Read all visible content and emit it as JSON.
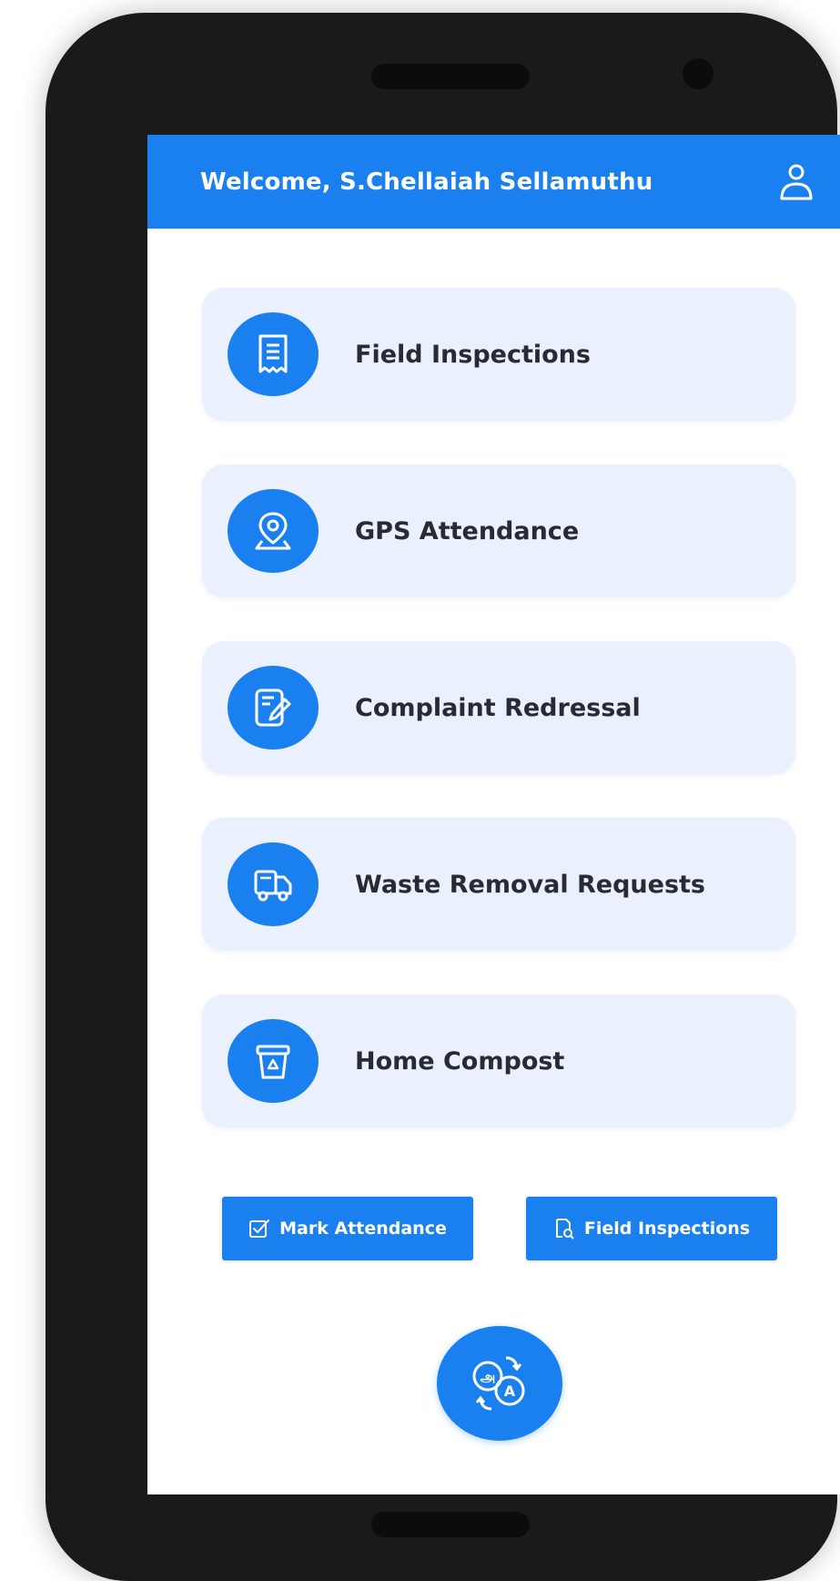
{
  "header": {
    "welcome_text": "Welcome, S.Chellaiah Sellamuthu",
    "profile_icon": "user-icon"
  },
  "menu": {
    "items": [
      {
        "label": "Field Inspections",
        "icon": "receipt-document-icon"
      },
      {
        "label": "GPS Attendance",
        "icon": "location-pin-icon"
      },
      {
        "label": "Complaint Redressal",
        "icon": "edit-document-icon"
      },
      {
        "label": "Waste Removal Requests",
        "icon": "truck-icon"
      },
      {
        "label": "Home Compost",
        "icon": "compost-bin-icon"
      }
    ]
  },
  "actions": {
    "mark_attendance_label": "Mark Attendance",
    "field_inspections_label": "Field Inspections"
  },
  "fab": {
    "icon": "translate-language-icon"
  },
  "colors": {
    "primary": "#1a80f0",
    "card_bg": "#eaf0fd",
    "phone_frame": "#1a1a1a",
    "text_dark": "#2a2a33"
  }
}
